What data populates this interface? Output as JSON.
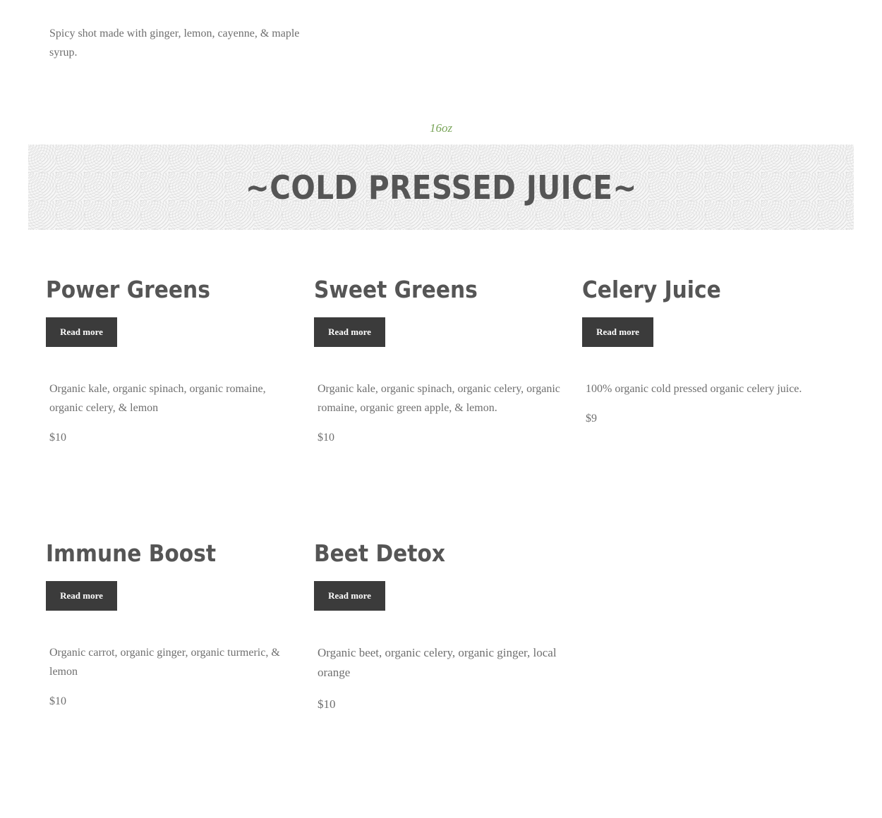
{
  "top_item": {
    "description": "Spicy shot made with ginger, lemon, cayenne, & maple syrup."
  },
  "section": {
    "size_label": "16oz",
    "title": "~COLD PRESSED JUICE~"
  },
  "read_more_label": "Read more",
  "items": [
    {
      "name": "Power Greens",
      "description": "Organic kale, organic spinach, organic romaine, organic celery, & lemon",
      "price": "$10"
    },
    {
      "name": "Sweet Greens",
      "description": "Organic kale, organic spinach, organic celery, organic romaine, organic green apple, & lemon.",
      "price": "$10"
    },
    {
      "name": "Celery Juice",
      "description": "100% organic cold pressed organic celery juice.",
      "price": "$9"
    },
    {
      "name": "Immune Boost",
      "description": "Organic carrot, organic ginger, organic turmeric, & lemon",
      "price": "$10"
    },
    {
      "name": "Beet Detox",
      "description": "Organic beet, organic celery, organic ginger, local orange",
      "price": "$10"
    }
  ]
}
